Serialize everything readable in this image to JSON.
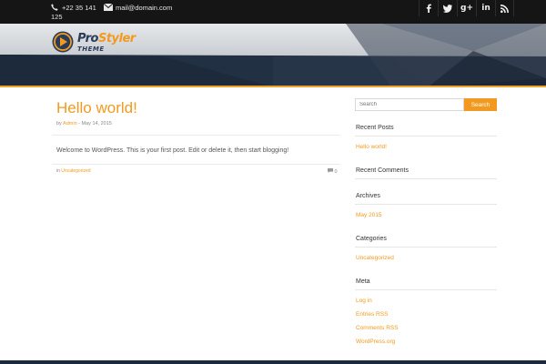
{
  "topbar": {
    "phone_line1": "+22 35 141",
    "phone_line2": "125",
    "email": "mail@domain.com",
    "social_icons": [
      "facebook-icon",
      "twitter-icon",
      "google-plus-icon",
      "linkedin-icon",
      "rss-icon"
    ],
    "social_glyphs": [
      "f",
      "t",
      "g+",
      "in",
      "rss"
    ]
  },
  "header": {
    "logo_pro": "Pro",
    "logo_styler": "Styler",
    "logo_theme": "THEME"
  },
  "post": {
    "title": "Hello world!",
    "meta_prefix": "by",
    "author": "Admin",
    "date": " - May 14, 2015",
    "body": "Welcome to WordPress. This is your first post. Edit or delete it, then start blogging!",
    "category_prefix": "in",
    "category": "Uncategorized",
    "comment_count": "0"
  },
  "sidebar": {
    "search_placeholder": "Search",
    "search_button": "Search",
    "recent_posts_title": "Recent Posts",
    "recent_posts": [
      "Hello world!"
    ],
    "recent_comments_title": "Recent Comments",
    "archives_title": "Archives",
    "archives": [
      "May 2015"
    ],
    "categories_title": "Categories",
    "categories": [
      "Uncategorized"
    ],
    "meta_title": "Meta",
    "meta_links": [
      "Log in",
      "Entries RSS",
      "Comments RSS",
      "WordPress.org"
    ]
  },
  "colors": {
    "accent": "#f29a1f",
    "dark": "#151515",
    "navy": "#2b3c58"
  }
}
